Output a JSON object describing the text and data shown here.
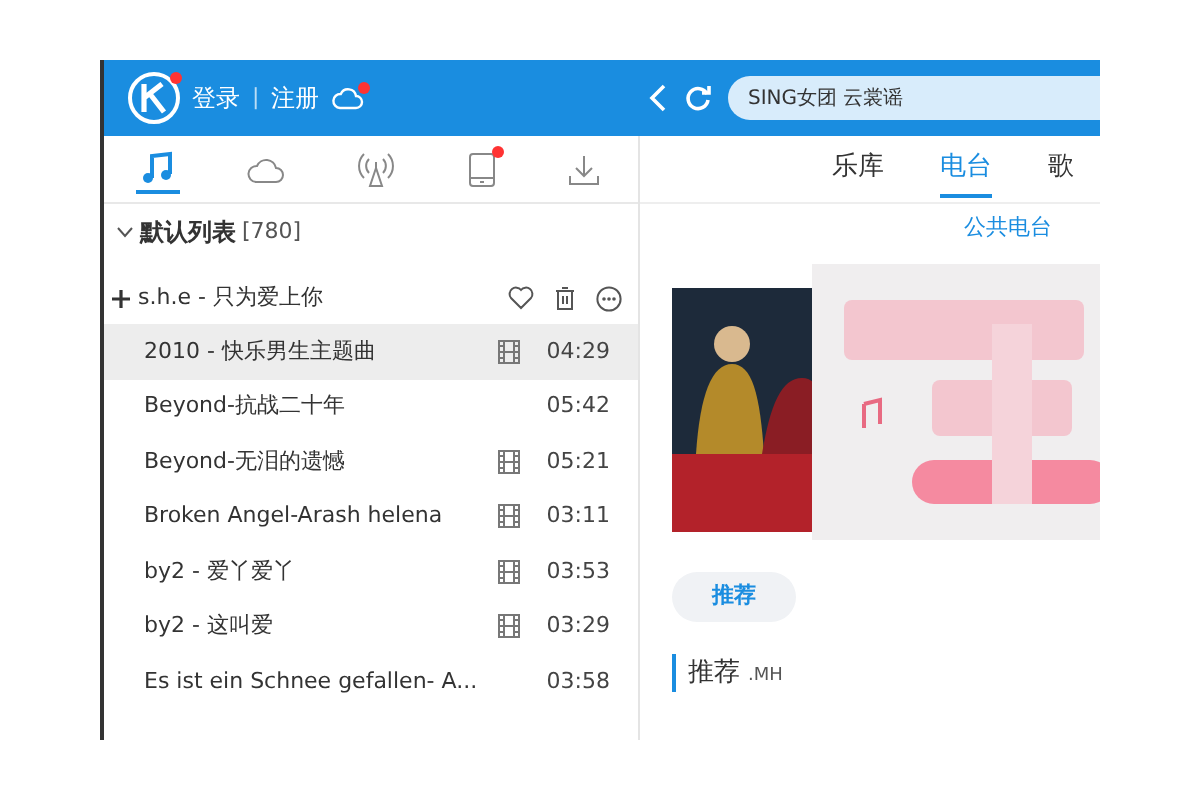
{
  "header": {
    "login": "登录",
    "separator": "|",
    "register": "注册",
    "search": {
      "value": "SING女团 云裳谣"
    }
  },
  "sidebar_tabs": [
    {
      "kind": "music",
      "selected": true,
      "badge": false
    },
    {
      "kind": "cloud",
      "selected": false,
      "badge": false
    },
    {
      "kind": "broadcast",
      "selected": false,
      "badge": false
    },
    {
      "kind": "phone",
      "selected": false,
      "badge": true
    },
    {
      "kind": "download",
      "selected": false,
      "badge": false
    }
  ],
  "playlist": {
    "title": "默认列表",
    "count": "[780]",
    "expanded": true
  },
  "now_playing": {
    "title": "s.h.e - 只为爱上你"
  },
  "songs": [
    {
      "title": "2010 - 快乐男生主题曲",
      "mv": true,
      "duration": "04:29",
      "selected": true
    },
    {
      "title": "Beyond-抗战二十年",
      "mv": false,
      "duration": "05:42",
      "selected": false
    },
    {
      "title": "Beyond-无泪的遗憾",
      "mv": true,
      "duration": "05:21",
      "selected": false
    },
    {
      "title": "Broken Angel-Arash helena",
      "mv": true,
      "duration": "03:11",
      "selected": false
    },
    {
      "title": "by2 - 爱丫爱丫",
      "mv": true,
      "duration": "03:53",
      "selected": false
    },
    {
      "title": "by2 - 这叫爱",
      "mv": true,
      "duration": "03:29",
      "selected": false
    },
    {
      "title": "Es ist ein Schnee gefallen- A...",
      "mv": false,
      "duration": "03:58",
      "selected": false
    }
  ],
  "nav_tabs": [
    {
      "label": "乐库",
      "selected": false
    },
    {
      "label": "电台",
      "selected": true
    },
    {
      "label": "歌",
      "selected": false
    }
  ],
  "sub_link": "公共电台",
  "pill": "推荐",
  "section": {
    "title": "推荐",
    "subtitle": ".MH"
  }
}
